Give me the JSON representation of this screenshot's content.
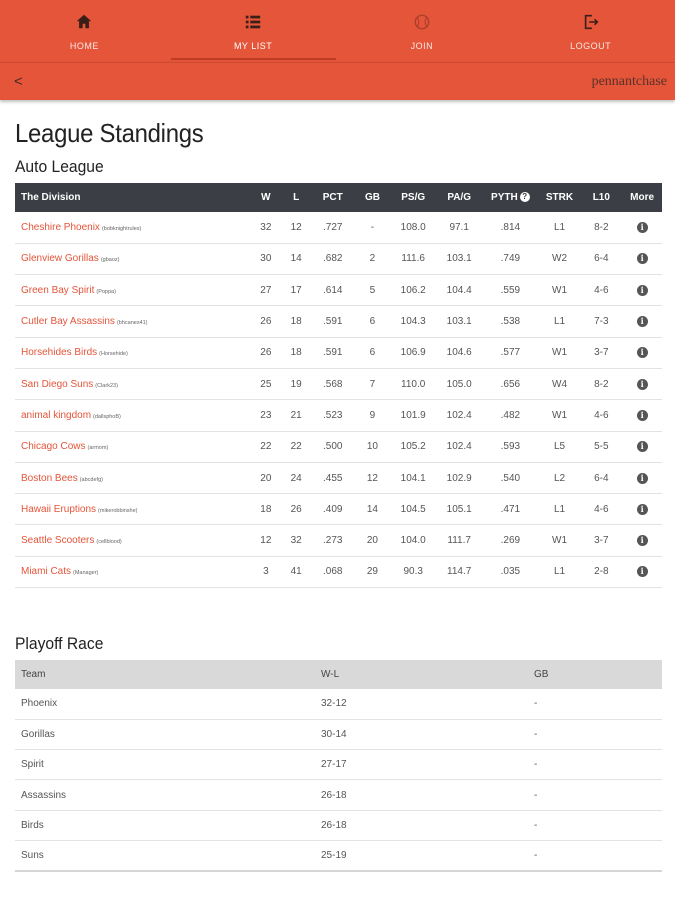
{
  "nav": [
    {
      "label": "HOME",
      "icon": "home-icon",
      "active": false
    },
    {
      "label": "MY LIST",
      "icon": "list-icon",
      "active": true
    },
    {
      "label": "JOIN",
      "icon": "baseball-icon",
      "active": false
    },
    {
      "label": "LOGOUT",
      "icon": "logout-icon",
      "active": false
    }
  ],
  "subbar": {
    "back": "<",
    "brand": "pennantchase"
  },
  "page_title": "League Standings",
  "league_name": "Auto League",
  "colors": {
    "accent": "#e4553a",
    "header_dark": "#3b3f45",
    "header_light": "#d9d9d9"
  },
  "standings": {
    "headers": [
      "The Division",
      "W",
      "L",
      "PCT",
      "GB",
      "PS/G",
      "PA/G",
      "PYTH",
      "STRK",
      "L10",
      "More"
    ],
    "rows": [
      {
        "team": "Cheshire Phoenix",
        "owner": "(bobknightrules)",
        "w": "32",
        "l": "12",
        "pct": ".727",
        "gb": "-",
        "psg": "108.0",
        "pag": "97.1",
        "pyth": ".814",
        "strk": "L1",
        "l10": "8-2"
      },
      {
        "team": "Glenview Gorillas",
        "owner": "(gbaoz)",
        "w": "30",
        "l": "14",
        "pct": ".682",
        "gb": "2",
        "psg": "111.6",
        "pag": "103.1",
        "pyth": ".749",
        "strk": "W2",
        "l10": "6-4"
      },
      {
        "team": "Green Bay Spirit",
        "owner": "(Poppa)",
        "w": "27",
        "l": "17",
        "pct": ".614",
        "gb": "5",
        "psg": "106.2",
        "pag": "104.4",
        "pyth": ".559",
        "strk": "W1",
        "l10": "4-6"
      },
      {
        "team": "Cutler Bay Assassins",
        "owner": "(bhcanes41)",
        "w": "26",
        "l": "18",
        "pct": ".591",
        "gb": "6",
        "psg": "104.3",
        "pag": "103.1",
        "pyth": ".538",
        "strk": "L1",
        "l10": "7-3"
      },
      {
        "team": "Horsehides Birds",
        "owner": "(Horsehide)",
        "w": "26",
        "l": "18",
        "pct": ".591",
        "gb": "6",
        "psg": "106.9",
        "pag": "104.6",
        "pyth": ".577",
        "strk": "W1",
        "l10": "3-7"
      },
      {
        "team": "San Diego Suns",
        "owner": "(Clark23)",
        "w": "25",
        "l": "19",
        "pct": ".568",
        "gb": "7",
        "psg": "110.0",
        "pag": "105.0",
        "pyth": ".656",
        "strk": "W4",
        "l10": "8-2"
      },
      {
        "team": "animal kingdom",
        "owner": "(dallsphoB)",
        "w": "23",
        "l": "21",
        "pct": ".523",
        "gb": "9",
        "psg": "101.9",
        "pag": "102.4",
        "pyth": ".482",
        "strk": "W1",
        "l10": "4-6"
      },
      {
        "team": "Chicago Cows",
        "owner": "(armom)",
        "w": "22",
        "l": "22",
        "pct": ".500",
        "gb": "10",
        "psg": "105.2",
        "pag": "102.4",
        "pyth": ".593",
        "strk": "L5",
        "l10": "5-5"
      },
      {
        "team": "Boston Bees",
        "owner": "(abcdefg)",
        "w": "20",
        "l": "24",
        "pct": ".455",
        "gb": "12",
        "psg": "104.1",
        "pag": "102.9",
        "pyth": ".540",
        "strk": "L2",
        "l10": "6-4"
      },
      {
        "team": "Hawaii Eruptions",
        "owner": "(mikerobbinshe)",
        "w": "18",
        "l": "26",
        "pct": ".409",
        "gb": "14",
        "psg": "104.5",
        "pag": "105.1",
        "pyth": ".471",
        "strk": "L1",
        "l10": "4-6"
      },
      {
        "team": "Seattle Scooters",
        "owner": "(cellblood)",
        "w": "12",
        "l": "32",
        "pct": ".273",
        "gb": "20",
        "psg": "104.0",
        "pag": "111.7",
        "pyth": ".269",
        "strk": "W1",
        "l10": "3-7"
      },
      {
        "team": "Miami Cats",
        "owner": "(Manager)",
        "w": "3",
        "l": "41",
        "pct": ".068",
        "gb": "29",
        "psg": "90.3",
        "pag": "114.7",
        "pyth": ".035",
        "strk": "L1",
        "l10": "2-8"
      }
    ]
  },
  "playoff": {
    "title": "Playoff Race",
    "headers": [
      "Team",
      "W-L",
      "GB"
    ],
    "rows": [
      {
        "team": "Phoenix",
        "wl": "32-12",
        "gb": "-"
      },
      {
        "team": "Gorillas",
        "wl": "30-14",
        "gb": "-"
      },
      {
        "team": "Spirit",
        "wl": "27-17",
        "gb": "-"
      },
      {
        "team": "Assassins",
        "wl": "26-18",
        "gb": "-"
      },
      {
        "team": "Birds",
        "wl": "26-18",
        "gb": "-"
      },
      {
        "team": "Suns",
        "wl": "25-19",
        "gb": "-"
      }
    ]
  }
}
